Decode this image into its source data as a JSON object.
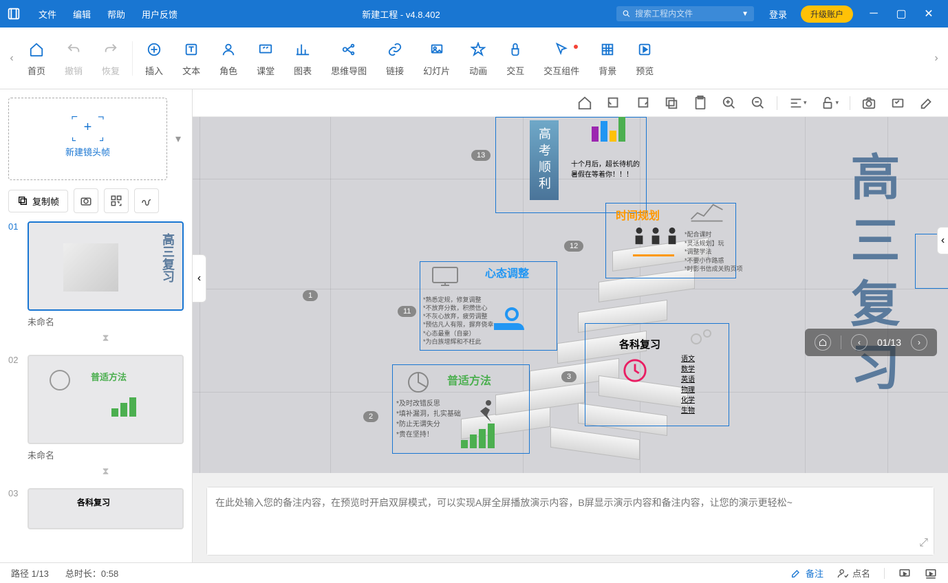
{
  "titlebar": {
    "menus": [
      "文件",
      "编辑",
      "帮助",
      "用户反馈"
    ],
    "title": "新建工程 - v4.8.402",
    "search_placeholder": "搜索工程内文件",
    "login": "登录",
    "upgrade": "升级账户"
  },
  "ribbon": {
    "items": [
      {
        "label": "首页",
        "icon": "home"
      },
      {
        "label": "撤销",
        "icon": "undo",
        "disabled": true
      },
      {
        "label": "恢复",
        "icon": "redo",
        "disabled": true
      },
      {
        "label": "插入",
        "icon": "plus-circle"
      },
      {
        "label": "文本",
        "icon": "text"
      },
      {
        "label": "角色",
        "icon": "person"
      },
      {
        "label": "课堂",
        "icon": "class"
      },
      {
        "label": "图表",
        "icon": "chart"
      },
      {
        "label": "思维导图",
        "icon": "mindmap"
      },
      {
        "label": "链接",
        "icon": "link"
      },
      {
        "label": "幻灯片",
        "icon": "slide"
      },
      {
        "label": "动画",
        "icon": "star"
      },
      {
        "label": "交互",
        "icon": "touch"
      },
      {
        "label": "交互组件",
        "icon": "cursor",
        "dot": true
      },
      {
        "label": "背景",
        "icon": "grid"
      },
      {
        "label": "预览",
        "icon": "play"
      }
    ]
  },
  "left_panel": {
    "new_frame": "新建镜头帧",
    "copy_frame": "复制帧",
    "thumbs": [
      {
        "num": "01",
        "name": "未命名",
        "active": true,
        "content": "高三复习"
      },
      {
        "num": "02",
        "name": "未命名",
        "active": false,
        "content": "普适方法"
      },
      {
        "num": "03",
        "name": "",
        "active": false,
        "content": "各科复习"
      }
    ]
  },
  "canvas": {
    "big_title": "高三复习",
    "sections": {
      "s1": "高考顺利",
      "s2": "时间规划",
      "s3": "心态调整",
      "s4": "各科复习",
      "s5": "普适方法"
    },
    "notes_s1": "十个月后，超长待机的暑假在等着你！！！",
    "notes_s4_items": [
      "语文",
      "数学",
      "英语",
      "物理",
      "化学",
      "生物"
    ],
    "notes_s5_items": [
      "*及时改错反思",
      "*填补漏洞，扎实基础",
      "*防止无谓失分",
      "*贵在坚持！"
    ],
    "notes_s3_items": [
      "*熟悉定规，修复调整",
      "*不放弃分数，积攒信心",
      "*不灰心放弃，疲劳调整",
      "*预估凡人有限，摒弃侥幸",
      "*心态最重（自豪）",
      "*为白族增辉和不枉此"
    ],
    "notes_s2_items": [
      "*配合课时",
      "*灵活规划】玩",
      "*调整学法",
      "*不要小作路惑",
      "*时影书信成关购页项"
    ],
    "badges": [
      "1",
      "2",
      "3",
      "11",
      "12",
      "13"
    ]
  },
  "notes": {
    "placeholder": "在此处输入您的备注内容，在预览时开启双屏模式，可以实现A屏全屏播放演示内容，B屏显示演示内容和备注内容，让您的演示更轻松~"
  },
  "navigator": {
    "page": "01/13"
  },
  "statusbar": {
    "path": "路径 1/13",
    "duration": "总时长：0:58",
    "notes": "备注",
    "roll": "点名"
  }
}
